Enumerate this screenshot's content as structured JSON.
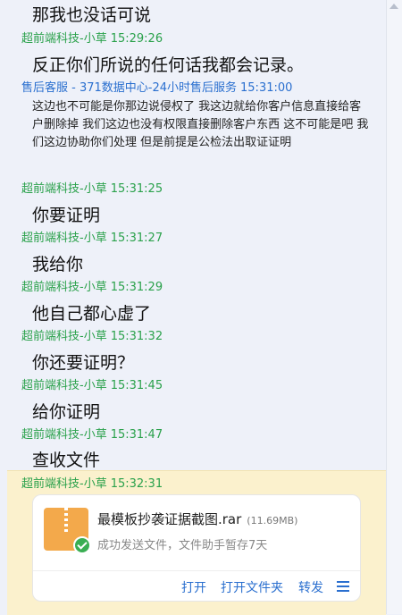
{
  "messages": [
    {
      "text": "那我也没话可说"
    },
    {
      "sender": "超前端科技-小草",
      "time": "15:29:26",
      "text": "反正你们所说的任何话我都会记录。"
    },
    {
      "sender": "售后客服 - 371数据中心-24小时售后服务",
      "time": "15:31:00",
      "text": "这边也不可能是你那边说侵权了 我这边就给你客户信息直接给客户删除掉 我们这边也没有权限直接删除客户东西 这不可能是吧  我们这边协助你们处理 但是前提是公检法出取证证明"
    },
    {
      "sender": "超前端科技-小草",
      "time": "15:31:25",
      "text": "你要证明"
    },
    {
      "sender": "超前端科技-小草",
      "time": "15:31:27",
      "text": "我给你"
    },
    {
      "sender": "超前端科技-小草",
      "time": "15:31:29",
      "text": "他自己都心虚了"
    },
    {
      "sender": "超前端科技-小草",
      "time": "15:31:32",
      "text": "你还要证明？"
    },
    {
      "sender": "超前端科技-小草",
      "time": "15:31:45",
      "text": "给你证明"
    },
    {
      "sender": "超前端科技-小草",
      "time": "15:31:47",
      "text": "查收文件"
    },
    {
      "sender": "超前端科技-小草",
      "time": "15:32:31"
    }
  ],
  "file": {
    "name": "最模板抄袭证据截图.rar",
    "size": "(11.69MB)",
    "status": "成功发送文件，文件助手暂存7天",
    "actions": {
      "open": "打开",
      "open_folder": "打开文件夹",
      "forward": "转发"
    }
  },
  "colors": {
    "user": "#2aa14b",
    "service": "#2a6fcf",
    "highlight": "#fbf1cd",
    "background": "#eef1f9"
  }
}
